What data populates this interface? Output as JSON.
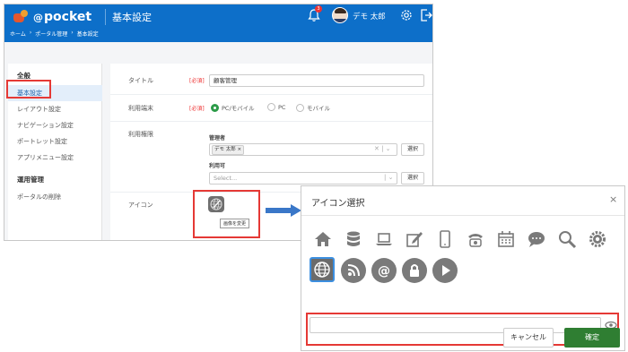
{
  "header": {
    "logo_prefix": "@",
    "logo_text": "pocket",
    "title": "基本設定",
    "user_name": "デモ 太郎",
    "notification_count": "3"
  },
  "breadcrumb": [
    "ホーム",
    "›",
    "ポータル管理",
    "›",
    "基本設定"
  ],
  "sidebar": {
    "section1": "全般",
    "items1": [
      "基本設定",
      "レイアウト設定",
      "ナビゲーション設定",
      "ポートレット設定",
      "アプリメニュー設定"
    ],
    "section2": "運用管理",
    "items2": [
      "ポータルの削除"
    ]
  },
  "form": {
    "title_label": "タイトル",
    "required": "[必須]",
    "title_value": "顧客管理",
    "device_label": "利用端末",
    "device_options": [
      "PC/モバイル",
      "PC",
      "モバイル"
    ],
    "device_selected": "PC/モバイル",
    "perm_label": "利用権限",
    "admin_label": "管理者",
    "admin_tag": "デモ 太郎",
    "admin_tag_remove": "×",
    "select_button": "選択",
    "user_label": "利用可",
    "user_placeholder": "Select...",
    "icon_label": "アイコン",
    "icon_tooltip": "画像を変更"
  },
  "modal": {
    "title": "アイコン選択",
    "close": "×",
    "icons": [
      "home-icon",
      "database-icon",
      "laptop-icon",
      "edit-icon",
      "smartphone-icon",
      "phone-icon",
      "calendar-icon",
      "chat-icon",
      "search-icon",
      "gear-icon",
      "globe-icon",
      "rss-icon",
      "at-icon",
      "lock-icon",
      "play-icon"
    ],
    "selected_icon": "globe-icon",
    "input_value": "",
    "cancel": "キャンセル",
    "confirm": "確定"
  },
  "colors": {
    "header": "#0d6fc9",
    "highlight": "#e53935",
    "confirm": "#2f7e32",
    "selected": "#3c8fe0"
  }
}
